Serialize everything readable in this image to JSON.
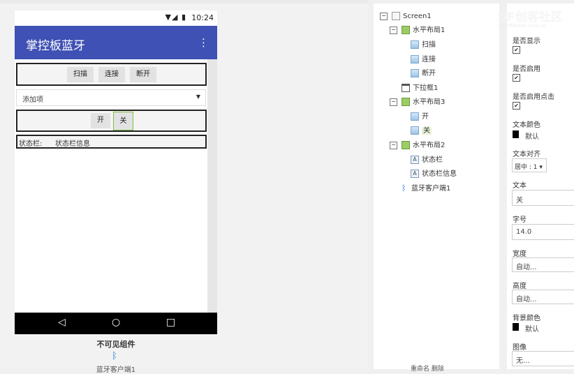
{
  "phone": {
    "status_time": "10:24",
    "status_signal": "▼◢ ▮",
    "app_title": "掌控板蓝牙",
    "menu_glyph": "⋮",
    "row1_buttons": [
      "扫描",
      "连接",
      "断开"
    ],
    "dropdown_value": "添加项",
    "dropdown_arrow": "▼",
    "row2_buttons": [
      "开",
      "关"
    ],
    "status_label": "状态栏:",
    "status_info": "状态栏信息",
    "nav_back": "◁",
    "nav_home": "○",
    "nav_recent": "□"
  },
  "nonvisible": {
    "title": "不可见组件",
    "bt_label": "蓝牙客户端1"
  },
  "tree": {
    "screen": "Screen1",
    "hbox1": "水平布局1",
    "btn_scan": "扫描",
    "btn_connect": "连接",
    "btn_disconnect": "断开",
    "listpicker": "下拉框1",
    "hbox3": "水平布局3",
    "btn_on": "开",
    "btn_off": "关",
    "hbox2": "水平布局2",
    "label_status": "状态栏",
    "label_info": "状态栏信息",
    "bt_client": "蓝牙客户端1",
    "toggle_minus": "−",
    "bottom_buttons": "重命名  删除"
  },
  "props": {
    "visible": "是否显示",
    "enabled": "是否启用",
    "clickable": "是否启用点击",
    "check": "✔",
    "text_color": "文本颜色",
    "text_color_value": "默认",
    "text_align": "文本对齐",
    "text_align_value": "居中 : 1 ▾",
    "text": "文本",
    "text_value": "关",
    "font_size": "字号",
    "font_size_value": "14.0",
    "width": "宽度",
    "width_value": "自动...",
    "height": "高度",
    "height_value": "自动...",
    "bg_color": "背景颜色",
    "bg_color_value": "默认",
    "image": "图像",
    "image_value": "无..."
  },
  "watermark": {
    "brand": "DF创客社区",
    "url": "mc.DFRobot.com.cn"
  },
  "colors": {
    "app_bar": "#3f51b5",
    "nav_bar": "#000000",
    "selected_node": "#e8f3d8"
  }
}
